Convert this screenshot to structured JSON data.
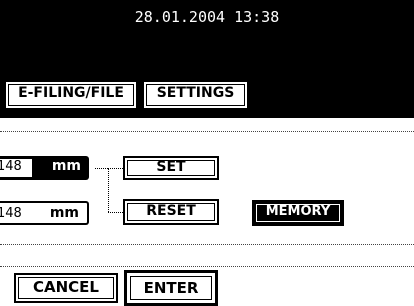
{
  "header": {
    "datetime": "28.01.2004 13:38"
  },
  "tabs": [
    {
      "label": "E-FILING/FILE"
    },
    {
      "label": "SETTINGS"
    }
  ],
  "fields": {
    "first": {
      "value": "148",
      "unit": "mm"
    },
    "second": {
      "value": "148",
      "unit": "mm"
    }
  },
  "buttons": {
    "set": "SET",
    "reset": "RESET",
    "memory": "MEMORY",
    "cancel": "CANCEL",
    "enter": "ENTER"
  }
}
